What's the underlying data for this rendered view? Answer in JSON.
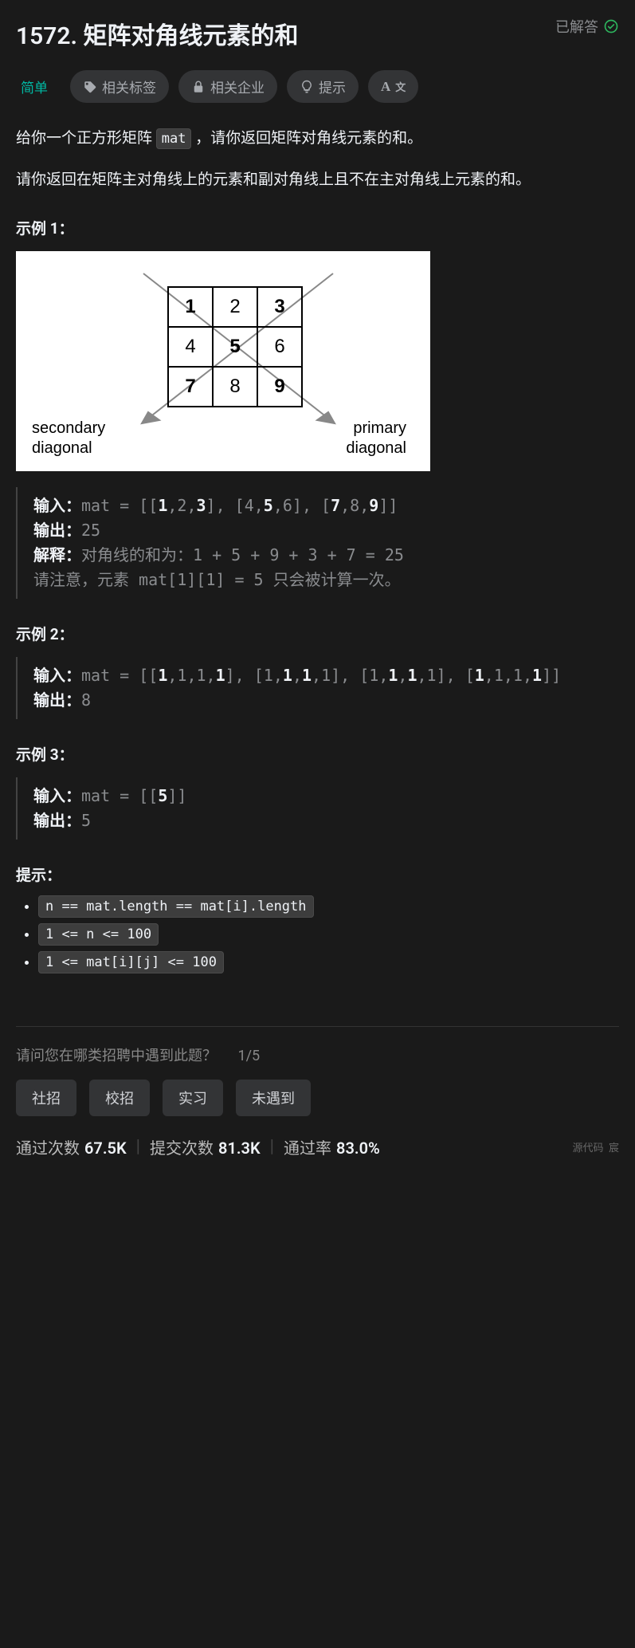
{
  "header": {
    "title": "1572. 矩阵对角线元素的和",
    "solved_label": "已解答"
  },
  "tags": {
    "difficulty": "简单",
    "related_tags": "相关标签",
    "related_companies": "相关企业",
    "hint": "提示"
  },
  "description": {
    "p1_pre": "给你一个正方形矩阵 ",
    "p1_code": "mat",
    "p1_post": " ，请你返回矩阵对角线元素的和。",
    "p2": "请你返回在矩阵主对角线上的元素和副对角线上且不在主对角线上元素的和。"
  },
  "examples": {
    "label1": "示例  1：",
    "label2": "示例  2：",
    "label3": "示例 3：",
    "input_label": "输入：",
    "output_label": "输出：",
    "explain_label": "解释：",
    "ex1": {
      "out": "25",
      "explain": "对角线的和为：1 + 5 + 9 + 3 + 7 = 25",
      "note": "请注意，元素 mat[1][1] = 5 只会被计算一次。"
    },
    "ex2": {
      "out": "8"
    },
    "ex3": {
      "out": "5"
    }
  },
  "diagram": {
    "secondary": "secondary\ndiagonal",
    "primary": "primary\ndiagonal",
    "cells": [
      [
        "1",
        "2",
        "3"
      ],
      [
        "4",
        "5",
        "6"
      ],
      [
        "7",
        "8",
        "9"
      ]
    ]
  },
  "constraints": {
    "label": "提示：",
    "items": [
      "n == mat.length == mat[i].length",
      "1 <= n <= 100",
      "1 <= mat[i][j] <= 100"
    ]
  },
  "poll": {
    "question": "请问您在哪类招聘中遇到此题？",
    "progress": "1/5",
    "options": [
      "社招",
      "校招",
      "实习",
      "未遇到"
    ]
  },
  "stats": {
    "accepted_label": "通过次数",
    "accepted": "67.5K",
    "submissions_label": "提交次数",
    "submissions": "81.3K",
    "rate_label": "通过率",
    "rate": "83.0%"
  },
  "footer": {
    "source": "源代码",
    "other": "宸"
  }
}
